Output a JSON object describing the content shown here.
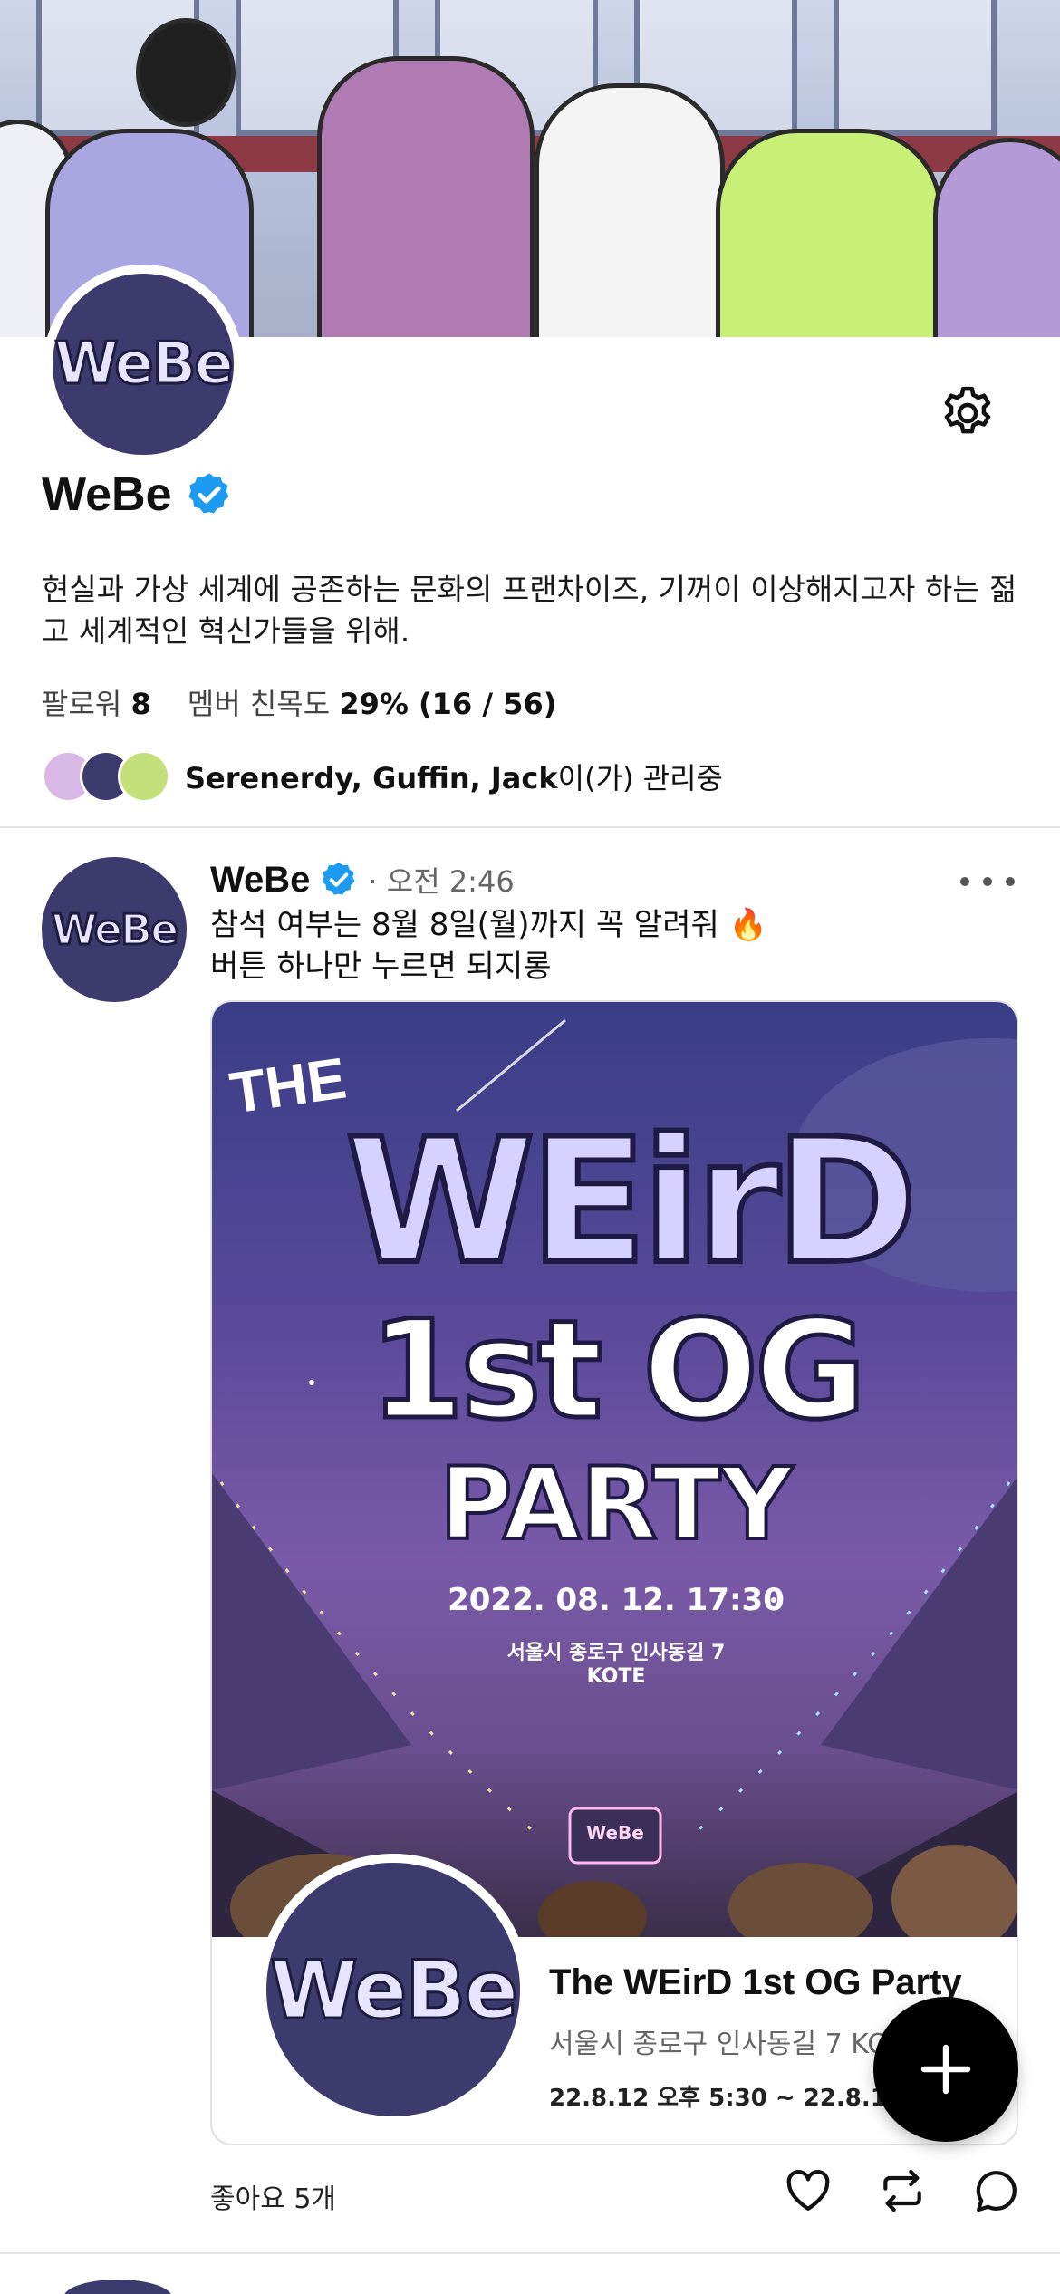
{
  "banner": {
    "alt": ""
  },
  "profile": {
    "logo_text": "WeBe",
    "name": "WeBe",
    "bio": "현실과 가상 세계에 공존하는 문화의 프랜차이즈, 기꺼이 이상해지고자 하는 젊고 세계적인 혁신가들을 위해.",
    "followers_label": "팔로워",
    "followers_value": "8",
    "intimacy_label": "멤버 친목도",
    "intimacy_value": "29% (16 / 56)",
    "admins_names": "Serenerdy, Guffin, Jack",
    "admins_suffix": "이(가) 관리중"
  },
  "post": {
    "author": "WeBe",
    "time": "· 오전 2:46",
    "text_line1": "참석 여부는 8월 8일(월)까지 꼭 알려줘 🔥",
    "text_line2": "버튼 하나만 누르면 되지롱",
    "poster": {
      "the": "THE",
      "weird": "WEirD",
      "og": "1st OG",
      "party": "PARTY",
      "datetime": "2022. 08. 12.  17:30",
      "address": "서울시 종로구 인사동길 7",
      "venue": "KOTE",
      "sign": "WeBe"
    },
    "card": {
      "title": "The WEirD 1st OG Party",
      "location": "서울시 종로구 인사동길 7 KOTE",
      "date": "22.8.12 오후 5:30 ~ 22.8.12"
    },
    "likes": "좋아요 5개"
  },
  "colors": {
    "accent": "#1d9bf0",
    "logo_bg": "#3d3a6e"
  },
  "icons": {
    "settings": "gear-icon",
    "verified": "verified-badge-icon",
    "more": "more-icon",
    "like": "heart-icon",
    "repost": "repost-icon",
    "comment": "comment-icon",
    "compose": "plus-icon"
  }
}
